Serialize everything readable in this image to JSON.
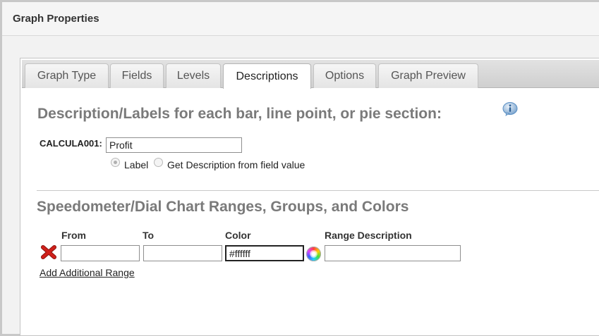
{
  "header": {
    "title": "Graph Properties"
  },
  "tabs": [
    {
      "label": "Graph Type",
      "active": false
    },
    {
      "label": "Fields",
      "active": false
    },
    {
      "label": "Levels",
      "active": false
    },
    {
      "label": "Descriptions",
      "active": true
    },
    {
      "label": "Options",
      "active": false
    },
    {
      "label": "Graph Preview",
      "active": false
    }
  ],
  "descriptions": {
    "title": "Description/Labels for each bar, line point, or pie section:",
    "info_icon": "info-icon",
    "field_label": "CALCULA001:",
    "field_value": "Profit",
    "radio_options": [
      {
        "label": "Label",
        "selected": true
      },
      {
        "label": "Get Description from field value",
        "selected": false
      }
    ]
  },
  "ranges": {
    "title": "Speedometer/Dial Chart Ranges, Groups, and Colors",
    "columns": [
      "From",
      "To",
      "Color",
      "Range Description"
    ],
    "rows": [
      {
        "from": "",
        "to": "",
        "color": "#ffffff",
        "description": ""
      }
    ],
    "add_link": "Add Additional Range",
    "delete_icon": "delete-x-icon",
    "color_picker_icon": "color-wheel-icon"
  },
  "colors": {
    "section_title": "#7a7a7a",
    "delete_red": "#d0201a",
    "info_blue": "#5a8fc4"
  }
}
